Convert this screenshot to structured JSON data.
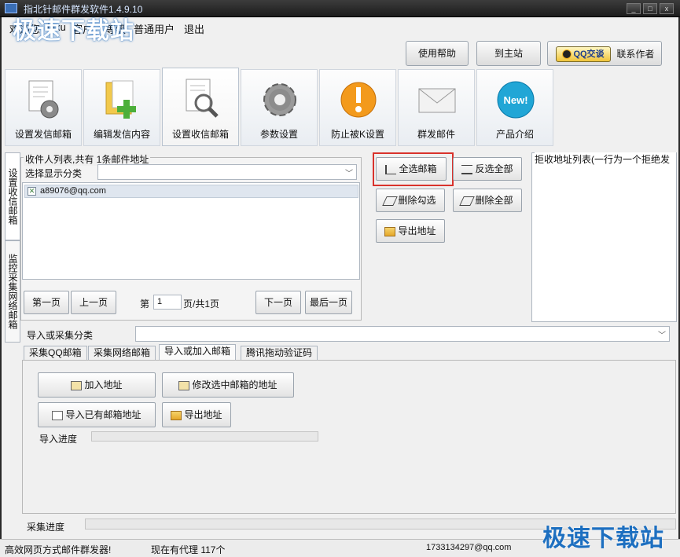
{
  "window": {
    "title": "指北针邮件群发软件1.4.9.10",
    "min": "_",
    "max": "□",
    "close": "x"
  },
  "menu": {
    "welcome": "欢迎您",
    "user": "luxu",
    "member": "客户",
    "level_label": "等级",
    "level": "普通用户",
    "logout": "退出"
  },
  "top_buttons": {
    "help": "使用帮助",
    "home": "到主站",
    "qq": "QQ交谈",
    "contact": "联系作者"
  },
  "tiles": [
    {
      "label": "设置发信邮箱"
    },
    {
      "label": "编辑发信内容"
    },
    {
      "label": "设置收信邮箱"
    },
    {
      "label": "参数设置"
    },
    {
      "label": "防止被K设置"
    },
    {
      "label": "群发邮件"
    },
    {
      "label": "产品介绍"
    }
  ],
  "new_badge": "New!",
  "side_tabs": {
    "tab1": "设置收信邮箱",
    "tab2": "监控采集网络邮箱"
  },
  "recipients": {
    "legend": "收件人列表,共有 1条邮件地址",
    "category_label": "选择显示分类",
    "items": [
      "a89076@qq.com"
    ],
    "first": "第一页",
    "prev": "上一页",
    "page_prefix": "第",
    "page_value": "1",
    "page_suffix": "页/共1页",
    "next": "下一页",
    "last": "最后一页"
  },
  "actions": {
    "select_all": "全选邮箱",
    "invert": "反选全部",
    "delete_checked": "删除勾选",
    "delete_all": "删除全部",
    "export": "导出地址"
  },
  "reject": {
    "legend": "拒收地址列表(一行为一个拒绝发"
  },
  "import": {
    "category_label": "导入或采集分类",
    "tabs": [
      "采集QQ邮箱",
      "采集网络邮箱",
      "导入或加入邮箱",
      "腾讯拖动验证码"
    ],
    "add": "加入地址",
    "modify": "修改选中邮箱的地址",
    "import_existing": "导入已有邮箱地址",
    "export": "导出地址",
    "progress_label": "导入进度",
    "progress": 0,
    "collect_label": "采集进度",
    "collect_progress": 0
  },
  "status": {
    "left": "高效网页方式邮件群发器!",
    "proxy": "现在有代理 117个",
    "email": "1733134297@qq.com"
  },
  "watermarks": {
    "top": "极速下载站",
    "bottom": "极速下载站"
  },
  "colors": {
    "highlight_red": "#d9322c",
    "title_bar": "#2a2a2a"
  }
}
